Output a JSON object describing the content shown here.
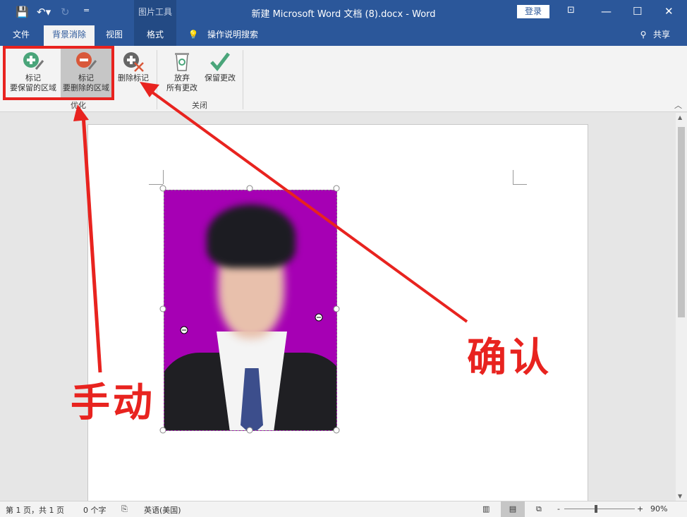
{
  "window": {
    "title": "新建 Microsoft Word 文档 (8).docx  -  Word",
    "context_tab_group": "图片工具",
    "login": "登录"
  },
  "tabs": [
    {
      "label": "文件"
    },
    {
      "label": "背景消除"
    },
    {
      "label": "视图"
    },
    {
      "label": "格式"
    }
  ],
  "tell_me": "操作说明搜索",
  "share": "共享",
  "ribbon": {
    "mark_keep": {
      "line1": "标记",
      "line2": "要保留的区域"
    },
    "mark_remove": {
      "line1": "标记",
      "line2": "要删除的区域"
    },
    "delete_mark": "删除标记",
    "discard": {
      "line1": "放弃",
      "line2": "所有更改"
    },
    "keep_changes": "保留更改",
    "group_refine": "优化",
    "group_close": "关闭"
  },
  "annotations": {
    "manual": "手动",
    "confirm": "确认"
  },
  "status": {
    "page": "第 1 页，共 1 页",
    "words": "0 个字",
    "language": "英语(美国)",
    "zoom": "90%"
  },
  "colors": {
    "accent": "#2b579a",
    "annotation": "#e8231f",
    "photo_bg": "#a600b4"
  }
}
